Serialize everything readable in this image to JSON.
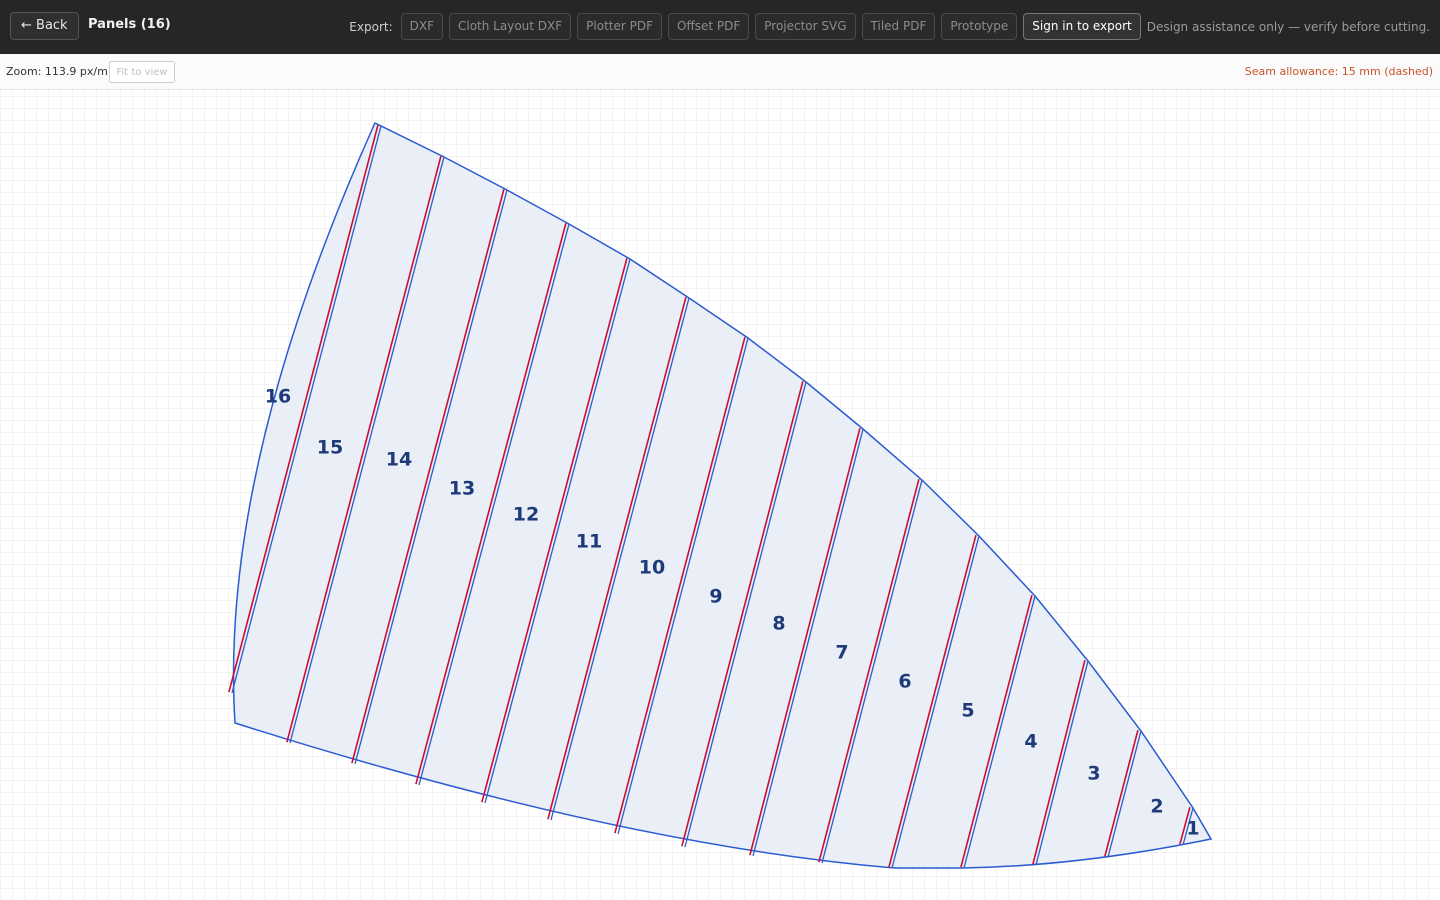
{
  "header": {
    "back_label": "← Back",
    "title": "Panels (16)",
    "export_label": "Export:",
    "export_buttons": [
      "DXF",
      "Cloth Layout DXF",
      "Plotter PDF",
      "Offset PDF",
      "Projector SVG",
      "Tiled PDF",
      "Prototype"
    ],
    "signin_label": "Sign in to export",
    "disclaimer": "Design assistance only — verify before cutting."
  },
  "toolbar": {
    "zoom_label": "Zoom: 113.9 px/m",
    "fit_label": "Fit to view",
    "seam_note": "Seam allowance: 15 mm (dashed)"
  },
  "canvas": {
    "panel_count": 16,
    "panel_labels": [
      "1",
      "2",
      "3",
      "4",
      "5",
      "6",
      "7",
      "8",
      "9",
      "10",
      "11",
      "12",
      "13",
      "14",
      "15",
      "16"
    ]
  },
  "colors": {
    "panel_fill": "#e9eef7",
    "panel_outline": "#2b5bd1",
    "seam_line": "#c8102e",
    "label": "#1e3a78",
    "grid": "#e7e7e7"
  }
}
